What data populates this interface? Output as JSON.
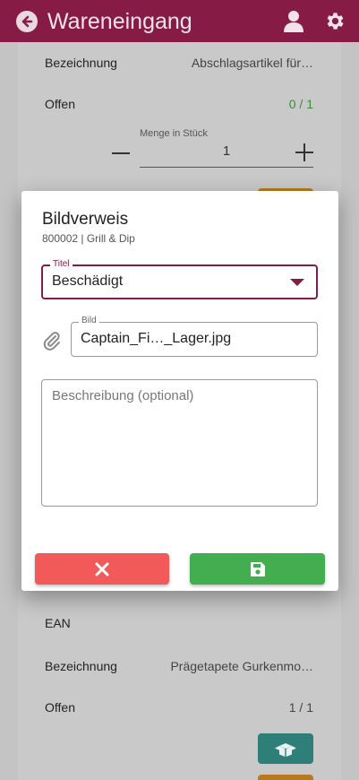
{
  "header": {
    "title": "Wareneingang",
    "back_icon": "arrow-left-circle-icon",
    "user_icon": "user-icon",
    "settings_icon": "gear-icon",
    "color": "#861c46"
  },
  "article_top": {
    "bezeichnung_label": "Bezeichnung",
    "bezeichnung_value": "Abschlagsartikel für…",
    "offen_label": "Offen",
    "offen_value": "0 / 1",
    "menge_label": "Menge in Stück",
    "menge_value": "1"
  },
  "dialog": {
    "title": "Bildverweis",
    "subtitle": "800002 | Grill & Dip",
    "titel_field": {
      "label": "Titel",
      "value": "Beschädigt"
    },
    "bild_field": {
      "label": "Bild",
      "value": "Captain_Fi…_Lager.jpg"
    },
    "beschreibung_field": {
      "placeholder": "Beschreibung (optional)"
    },
    "cancel_icon": "close-icon",
    "save_icon": "save-icon",
    "cancel_color": "#f25a5a",
    "save_color": "#43ae50"
  },
  "article_bottom": {
    "ean_label": "EAN",
    "bezeichnung_label": "Bezeichnung",
    "bezeichnung_value": "Prägetapete Gurkenmo…",
    "offen_label": "Offen",
    "offen_value": "1 / 1",
    "box_icon": "open-box-icon"
  }
}
